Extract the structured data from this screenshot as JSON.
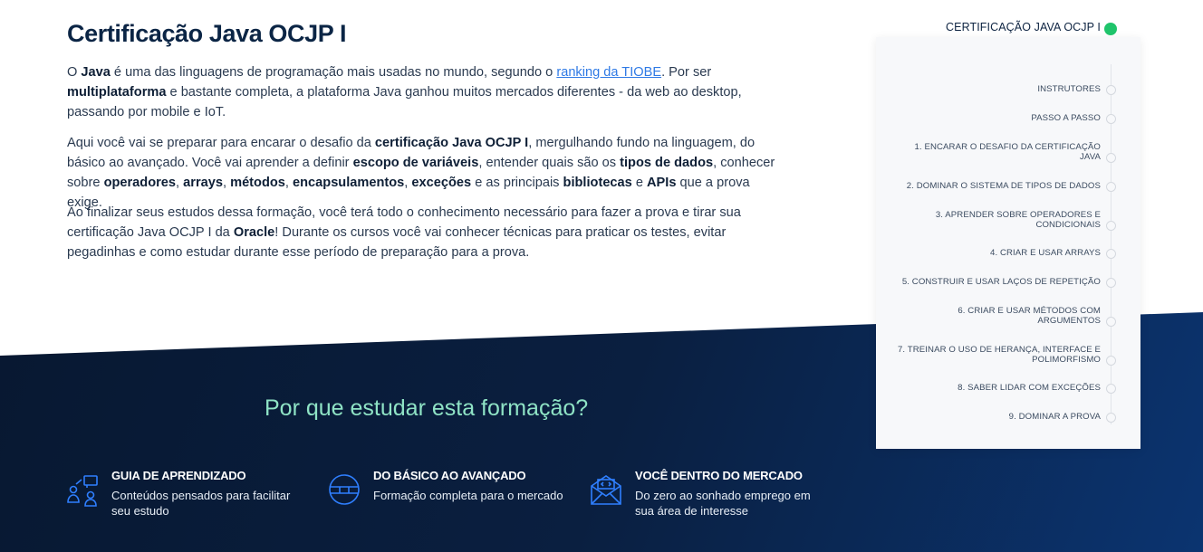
{
  "intro": {
    "title": "Certificação Java OCJP I",
    "p1": [
      {
        "t": "O ",
        "s": "n"
      },
      {
        "t": "Java",
        "s": "b"
      },
      {
        "t": " é uma das linguagens de programação mais usadas no mundo, segundo o ",
        "s": "n"
      },
      {
        "t": "ranking da TIOBE",
        "s": "a"
      },
      {
        "t": ". Por ser ",
        "s": "n"
      },
      {
        "t": "multiplataforma",
        "s": "b"
      },
      {
        "t": " e bastante completa, a plataforma Java ganhou muitos mercados diferentes - da web ao desktop, passando por mobile e IoT.",
        "s": "n"
      }
    ],
    "p2": [
      {
        "t": "Aqui você vai se preparar para encarar o desafio da ",
        "s": "n"
      },
      {
        "t": "certificação Java OCJP I",
        "s": "b"
      },
      {
        "t": ", mergulhando fundo na linguagem, do básico ao avançado. Você vai aprender a definir ",
        "s": "n"
      },
      {
        "t": "escopo de variáveis",
        "s": "b"
      },
      {
        "t": ", entender quais são os ",
        "s": "n"
      },
      {
        "t": "tipos de dados",
        "s": "b"
      },
      {
        "t": ", conhecer sobre ",
        "s": "n"
      },
      {
        "t": "operadores",
        "s": "b"
      },
      {
        "t": ", ",
        "s": "n"
      },
      {
        "t": "arrays",
        "s": "b"
      },
      {
        "t": ", ",
        "s": "n"
      },
      {
        "t": "métodos",
        "s": "b"
      },
      {
        "t": ", ",
        "s": "n"
      },
      {
        "t": "encapsulamentos",
        "s": "b"
      },
      {
        "t": ", ",
        "s": "n"
      },
      {
        "t": "exceções",
        "s": "b"
      },
      {
        "t": " e as principais ",
        "s": "n"
      },
      {
        "t": "bibliotecas",
        "s": "b"
      },
      {
        "t": " e ",
        "s": "n"
      },
      {
        "t": "APIs",
        "s": "b"
      },
      {
        "t": " que a prova exige.",
        "s": "n"
      }
    ],
    "p3": [
      {
        "t": "Ao finalizar seus estudos dessa formação, você terá todo o conhecimento necessário para fazer a prova e tirar sua certificação Java OCJP I da ",
        "s": "n"
      },
      {
        "t": "Oracle",
        "s": "b"
      },
      {
        "t": "! Durante os cursos você vai conhecer técnicas para praticar os testes, evitar pegadinhas e como estudar durante esse período de preparação para a prova.",
        "s": "n"
      }
    ]
  },
  "why": {
    "title": "Por que estudar esta formação?",
    "features": [
      {
        "icon": "learning-guide-icon",
        "title": "GUIA DE APRENDIZADO",
        "desc": "Conteúdos pensados para facilitar seu estudo"
      },
      {
        "icon": "basic-to-advanced-icon",
        "title": "DO BÁSICO AO AVANÇADO",
        "desc": "Formação completa para o mercado"
      },
      {
        "icon": "market-envelope-icon",
        "title": "VOCÊ DENTRO DO MERCADO",
        "desc": "Do zero ao sonhado emprego em sua área de interesse"
      }
    ]
  },
  "toc": {
    "active_color": "#1fc46b",
    "items": [
      {
        "label": "CERTIFICAÇÃO JAVA OCJP I",
        "active": true
      },
      {
        "label": "INSTRUTORES"
      },
      {
        "label": "PASSO A PASSO"
      },
      {
        "label": "1. ENCARAR O DESAFIO DA CERTIFICAÇÃO JAVA",
        "lines": [
          "1. ENCARAR O DESAFIO DA CERTIFICAÇÃO",
          "JAVA"
        ]
      },
      {
        "label": "2. DOMINAR O SISTEMA DE TIPOS DE DADOS"
      },
      {
        "label": "3. APRENDER SOBRE OPERADORES E CONDICIONAIS",
        "lines": [
          "3. APRENDER SOBRE OPERADORES E",
          "CONDICIONAIS"
        ]
      },
      {
        "label": "4. CRIAR E USAR ARRAYS"
      },
      {
        "label": "5. CONSTRUIR E USAR LAÇOS DE REPETIÇÃO"
      },
      {
        "label": "6. CRIAR E USAR MÉTODOS COM ARGUMENTOS",
        "lines": [
          "6. CRIAR E USAR MÉTODOS COM",
          "ARGUMENTOS"
        ]
      },
      {
        "label": "7. TREINAR O USO DE HERANÇA, INTERFACE E POLIMORFISMO",
        "lines": [
          "7. TREINAR O USO DE HERANÇA, INTERFACE E",
          "POLIMORFISMO"
        ]
      },
      {
        "label": "8. SABER LIDAR COM EXCEÇÕES"
      },
      {
        "label": "9. DOMINAR A PROVA"
      }
    ]
  }
}
